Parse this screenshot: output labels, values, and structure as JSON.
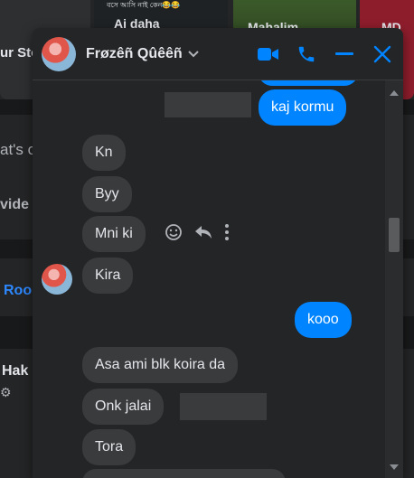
{
  "background": {
    "story_labels": [
      "ur Sto",
      "Ai daha",
      "Mahalim",
      "MD"
    ],
    "story_subtext": "বসে আসি নাই কেন😂😂",
    "composer_placeholder_fragment": "at's o",
    "video_fragment": "vide",
    "room_fragment": "Roo",
    "hak_fragment": "Hak"
  },
  "chat": {
    "contact_name": "Frøzêñ Qûêêñ",
    "icons": {
      "video": "video-camera-icon",
      "call": "phone-icon",
      "minimize": "minimize-icon",
      "close": "close-icon"
    },
    "accent_color": "#0084ff",
    "messages": [
      {
        "from": "me",
        "text": "kaj kormu"
      },
      {
        "from": "them",
        "text": "Kn"
      },
      {
        "from": "them",
        "text": "Byy"
      },
      {
        "from": "them",
        "text": "Mni ki"
      },
      {
        "from": "them",
        "text": "Kira"
      },
      {
        "from": "me",
        "text": "kooo"
      },
      {
        "from": "them",
        "text": "Asa ami blk koira da"
      },
      {
        "from": "them",
        "text": "Onk jalai"
      },
      {
        "from": "them",
        "text": "Tora"
      }
    ]
  }
}
